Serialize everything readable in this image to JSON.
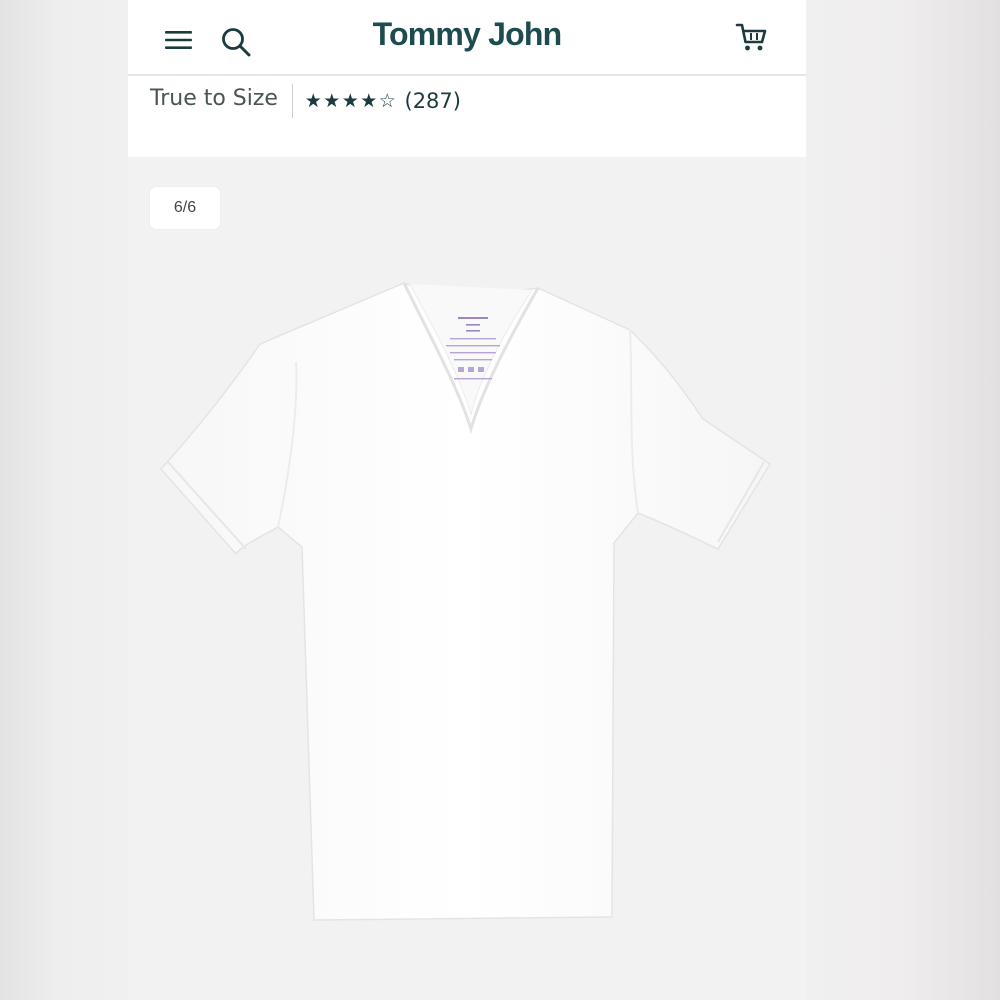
{
  "header": {
    "brand": "Tommy John",
    "icons": {
      "menu": "menu-icon",
      "search": "search-icon",
      "cart": "cart-icon"
    }
  },
  "product_summary": {
    "fit": "True to Size",
    "rating": {
      "value": 4,
      "max": 5,
      "count_text": "(287)"
    }
  },
  "gallery": {
    "counter": "6/6",
    "image": "white v-neck t-shirt"
  },
  "colors": {
    "brand": "#1d4b4f",
    "star": "#1d3b3e",
    "gallery_bg": "#f2f2f2",
    "tag_print": "#8a6fb5"
  }
}
